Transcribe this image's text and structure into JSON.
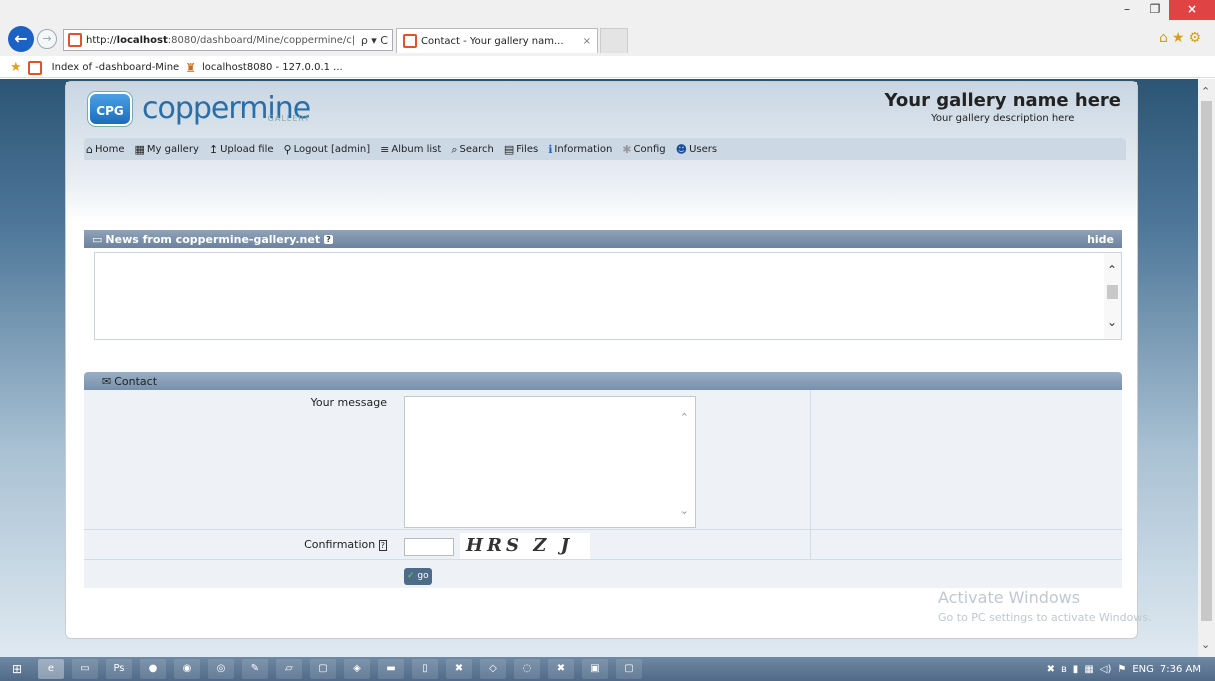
{
  "browser": {
    "url_prefix": "http://",
    "url_host": "localhost",
    "url_rest": ":8080/dashboard/Mine/coppermine/c|",
    "url_controls": "ρ ▾ C",
    "tab_title": "Contact - Your gallery nam...",
    "tab_close": "×",
    "fav_items": [
      "Index of -dashboard-Mine",
      "localhost8080 - 127.0.0.1 ..."
    ]
  },
  "site": {
    "logo_badge": "CPG",
    "logo_text": "coppermine",
    "logo_sub": "GALLERY",
    "gallery_name": "Your gallery name here",
    "gallery_desc": "Your gallery description here"
  },
  "nav": [
    {
      "icon": "⌂",
      "label": "Home"
    },
    {
      "icon": "▦",
      "label": "My gallery"
    },
    {
      "icon": "↥",
      "label": "Upload file"
    },
    {
      "icon": "⚲",
      "label": "Logout [admin]"
    },
    {
      "icon": "≡",
      "label": "Album list"
    },
    {
      "icon": "⌕",
      "label": "Search"
    },
    {
      "icon": "▤",
      "label": "Files"
    },
    {
      "icon": "ℹ",
      "label": "Information"
    },
    {
      "icon": "✱",
      "label": "Config"
    },
    {
      "icon": "☻",
      "label": "Users"
    }
  ],
  "news": {
    "title": "News from coppermine-gallery.net",
    "help": "?",
    "hide": "hide"
  },
  "contact": {
    "title": "Contact",
    "message_label": "Your message",
    "confirmation_label": "Confirmation",
    "confirmation_help": "?",
    "captcha_text": "HRS Z J",
    "go_label": "go"
  },
  "watermark": {
    "line1": "Activate Windows",
    "line2": "Go to PC settings to activate Windows."
  },
  "taskbar": {
    "lang": "ENG",
    "time": "7:36 AM"
  }
}
